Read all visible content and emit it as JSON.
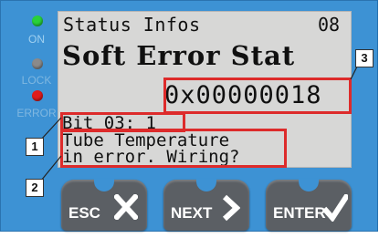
{
  "leds": [
    {
      "label": "ON",
      "color": "#29d13a",
      "label_color": "#9fd0f0"
    },
    {
      "label": "LOCK",
      "color": "#8a8a8a",
      "label_color": "#7fb7e0"
    },
    {
      "label": "ERROR",
      "color": "#e01b1b",
      "label_color": "#7fb7e0"
    }
  ],
  "lcd": {
    "title": "Status Infos",
    "page": "08",
    "heading": "Soft Error Stat",
    "code": "0x00000018",
    "bit_line": "Bit 03: 1",
    "message_line1": "Tube Temperature",
    "message_line2": "in error. Wiring?"
  },
  "callouts": {
    "one": "1",
    "two": "2",
    "three": "3"
  },
  "buttons": {
    "esc": {
      "label": "ESC",
      "icon": "x-icon"
    },
    "next": {
      "label": "NEXT",
      "icon": "chevron-right-icon"
    },
    "enter": {
      "label": "ENTER",
      "icon": "checkmark-icon"
    }
  },
  "colors": {
    "panel": "#3d92d4",
    "highlight": "#dd2b2b",
    "lcd": "#d7d7d6",
    "button": "#5b5f64"
  }
}
